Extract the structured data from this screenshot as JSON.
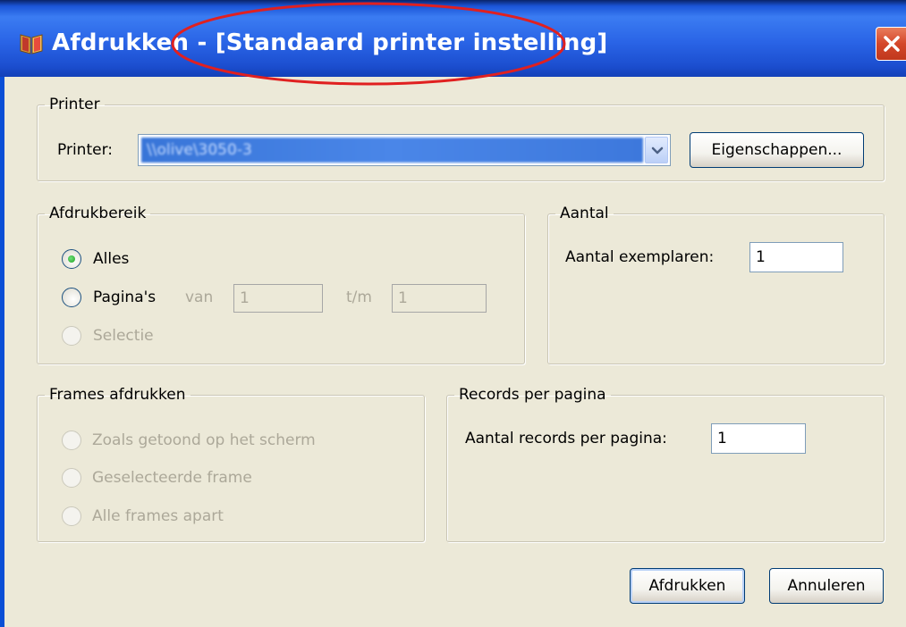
{
  "titlebar": {
    "title": "Afdrukken - [Standaard printer instelling]"
  },
  "printer_group": {
    "legend": "Printer",
    "printer_label": "Printer:",
    "printer_value": "\\\\olive\\3050-3",
    "properties_button": "Eigenschappen..."
  },
  "range_group": {
    "legend": "Afdrukbereik",
    "all_label": "Alles",
    "pages_label": "Pagina's",
    "from_label": "van",
    "from_value": "1",
    "to_label": "t/m",
    "to_value": "1",
    "selection_label": "Selectie",
    "selected": "all"
  },
  "count_group": {
    "legend": "Aantal",
    "copies_label": "Aantal exemplaren:",
    "copies_value": "1"
  },
  "frames_group": {
    "legend": "Frames afdrukken",
    "option_screen": "Zoals getoond op het scherm",
    "option_selected": "Geselecteerde frame",
    "option_separate": "Alle frames apart"
  },
  "records_group": {
    "legend": "Records per pagina",
    "records_label": "Aantal records per pagina:",
    "records_value": "1"
  },
  "footer": {
    "print_button": "Afdrukken",
    "cancel_button": "Annuleren"
  },
  "icons": {
    "app": "book-icon",
    "close": "close-icon",
    "dropdown": "chevron-down-icon"
  },
  "colors": {
    "titlebar": "#2a64e6",
    "dialog_bg": "#ece9d8",
    "close_button": "#d4472a",
    "annotation_ellipse": "#e02020"
  }
}
